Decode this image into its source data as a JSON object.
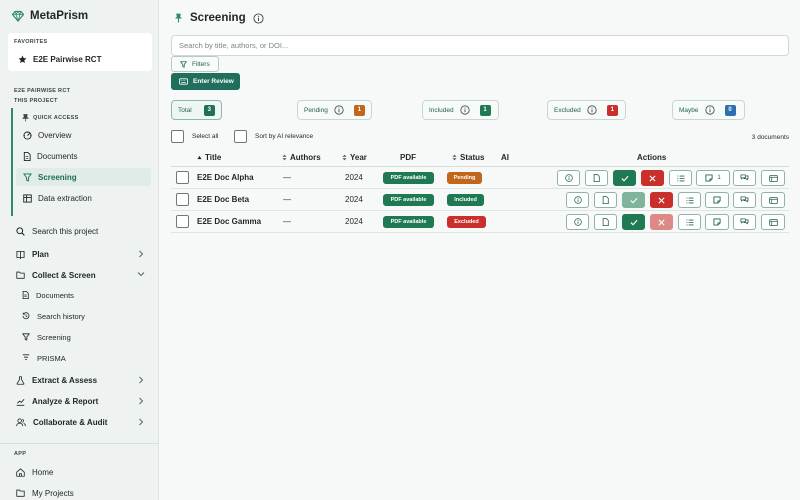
{
  "app": {
    "name": "MetaPrism"
  },
  "sidebar": {
    "favorites_caption": "FAVORITES",
    "favorite_item": "E2E Pairwise RCT",
    "project_caption": "E2E PAIRWISE RCT",
    "project_subcaption": "THIS PROJECT",
    "quick_access_caption": "QUICK ACCESS",
    "quick_access": [
      {
        "label": "Overview",
        "icon": "overview-icon"
      },
      {
        "label": "Documents",
        "icon": "document-icon"
      },
      {
        "label": "Screening",
        "icon": "filter-icon",
        "active": true
      },
      {
        "label": "Data extraction",
        "icon": "table-icon"
      }
    ],
    "search_label": "Search this project",
    "nav": [
      {
        "label": "Plan",
        "icon": "book-icon",
        "chevron": "right"
      },
      {
        "label": "Collect & Screen",
        "icon": "folder-icon",
        "chevron": "down"
      }
    ],
    "sub_items": [
      {
        "label": "Documents",
        "icon": "document-icon"
      },
      {
        "label": "Search history",
        "icon": "history-icon"
      },
      {
        "label": "Screening",
        "icon": "filter-icon"
      },
      {
        "label": "PRISMA",
        "icon": "flow-icon"
      }
    ],
    "nav_lower": [
      {
        "label": "Extract & Assess",
        "icon": "flask-icon"
      },
      {
        "label": "Analyze & Report",
        "icon": "chart-icon"
      },
      {
        "label": "Collaborate & Audit",
        "icon": "users-icon"
      }
    ],
    "app_caption": "APP",
    "app_items": [
      {
        "label": "Home",
        "icon": "home-icon"
      },
      {
        "label": "My Projects",
        "icon": "folder-icon"
      }
    ]
  },
  "main": {
    "title": "Screening",
    "search_placeholder": "Search by title, authors, or DOI...",
    "filters_label": "Filters",
    "enter_review_label": "Enter Review",
    "stats": [
      {
        "label": "Total",
        "count": "3",
        "color": "#1f6f5c"
      },
      {
        "label": "Pending",
        "count": "1",
        "color": "#c2661b"
      },
      {
        "label": "Included",
        "count": "1",
        "color": "#1f7a54"
      },
      {
        "label": "Excluded",
        "count": "1",
        "color": "#c9302c"
      },
      {
        "label": "Maybe",
        "count": "0",
        "color": "#2f6fb0"
      }
    ],
    "select_all_label": "Select all",
    "sort_ai_label": "Sort by AI relevance",
    "doc_count": "3 documents",
    "columns": {
      "title": "Title",
      "authors": "Authors",
      "year": "Year",
      "pdf": "PDF",
      "status": "Status",
      "ai": "AI",
      "actions": "Actions"
    },
    "rows": [
      {
        "title": "E2E Doc Alpha",
        "authors": "—",
        "year": "2024",
        "pdf": "PDF available",
        "status": "Pending",
        "status_color": "#c2661b",
        "note_count": "1"
      },
      {
        "title": "E2E Doc Beta",
        "authors": "—",
        "year": "2024",
        "pdf": "PDF available",
        "status": "Included",
        "status_color": "#1f7a54"
      },
      {
        "title": "E2E Doc Gamma",
        "authors": "—",
        "year": "2024",
        "pdf": "PDF available",
        "status": "Excluded",
        "status_color": "#c9302c"
      }
    ]
  }
}
